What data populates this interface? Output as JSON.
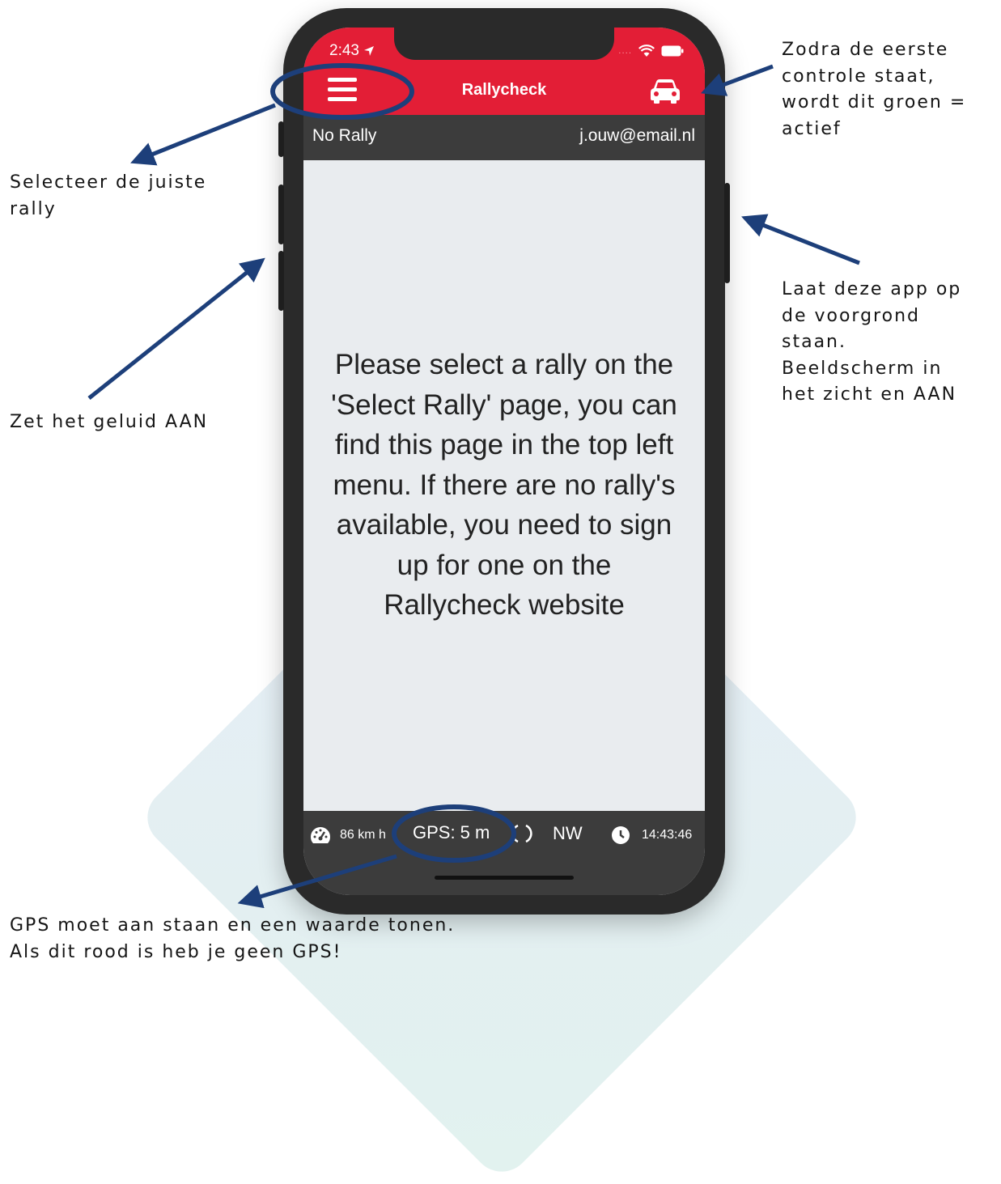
{
  "status_bar": {
    "time": "2:43"
  },
  "app": {
    "title": "Rallycheck",
    "rally_name": "No Rally",
    "user_email": "j.ouw@email.nl",
    "message": "Please select a rally on the 'Select Rally' page, you can find this page in the top left menu. If there are no rally's available, you need to sign up for one on the Rallycheck website"
  },
  "bottom_bar": {
    "speed": "86 km h",
    "gps": "GPS: 5 m",
    "heading": "NW",
    "clock": "14:43:46"
  },
  "annotations": {
    "top_right": [
      "Zodra de eerste",
      "controle staat,",
      "wordt dit groen =",
      "actief"
    ],
    "select_rally": [
      "Selecteer de juiste",
      "rally"
    ],
    "keep_foreground": [
      "Laat deze app op",
      "de voorgrond",
      "staan.",
      "Beeldscherm in",
      "het zicht en AAN"
    ],
    "sound": "Zet het geluid AAN",
    "gps": [
      "GPS moet aan staan en een waarde tonen.",
      "Als dit rood is heb je geen GPS!"
    ]
  },
  "colors": {
    "header_red": "#e31e36",
    "bar_gray": "#3c3c3c",
    "annotation_blue": "#1d3f7a"
  },
  "icons": [
    "hamburger-menu-icon",
    "car-icon",
    "speedometer-icon",
    "compass-icon",
    "clock-icon",
    "wifi-icon",
    "battery-icon",
    "location-arrow-icon"
  ]
}
